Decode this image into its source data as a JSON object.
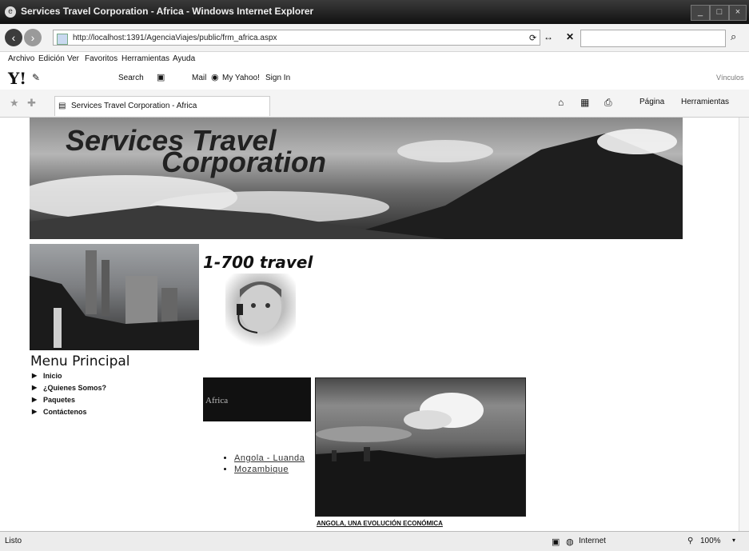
{
  "window": {
    "title": "Services Travel Corporation - Africa - Windows Internet Explorer",
    "url": "http://localhost:1391/AgenciaViajes/public/frm_africa.aspx"
  },
  "menubar": [
    "Archivo",
    "Edición",
    "Ver",
    "Favoritos",
    "Herramientas",
    "Ayuda"
  ],
  "yahoo_toolbar": {
    "logo": "Y!",
    "search_label": "Search",
    "mail_label": "Mail",
    "my_yahoo_label": "My Yahoo!",
    "sign_in_label": "Sign In",
    "vinculos_label": "Vínculos"
  },
  "tabs": {
    "active_tab_label": "Services Travel Corporation - Africa",
    "pagina_label": "Página",
    "herramientas_label": "Herramientas"
  },
  "page": {
    "banner_line1": "Services Travel",
    "banner_line2": "Corporation",
    "phone_text": "1-700 travel",
    "menu_title": "Menu Principal",
    "menu_items": [
      "Inicio",
      "¿Quienes Somos?",
      "Paquetes",
      "Contáctenos"
    ],
    "region_box_label": "Africa",
    "country_links": [
      "Angola - Luanda",
      "Mozambique"
    ],
    "image_caption": "ANGOLA, UNA EVOLUCIÓN ECONÓMICA"
  },
  "status": {
    "left_text": "Listo",
    "zone_text": "Internet",
    "zoom_text": "100%"
  },
  "colors": {
    "title_bar": "#1a1a1a",
    "region_box": "#111111",
    "page_background": "#ffffff"
  }
}
